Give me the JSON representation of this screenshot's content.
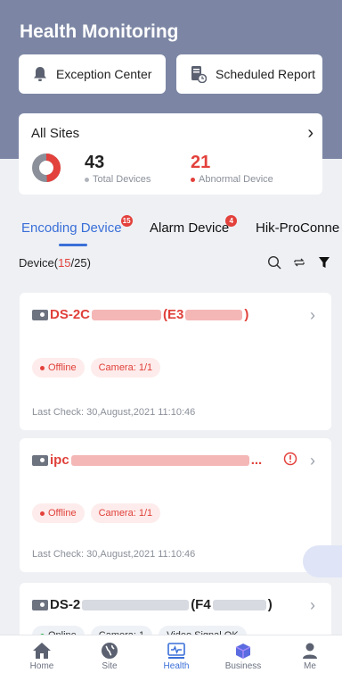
{
  "header": {
    "title": "Health Monitoring",
    "buttons": [
      {
        "label": "Exception Center",
        "icon": "bell-icon"
      },
      {
        "label": "Scheduled Report",
        "icon": "report-icon"
      }
    ]
  },
  "sites": {
    "title": "All Sites",
    "total_devices": "43",
    "total_label": "Total Devices",
    "abnormal_devices": "21",
    "abnormal_label": "Abnormal Device",
    "colors": {
      "abnormal": "#e3413c",
      "normal": "#8a8f99",
      "total_dot": "#b0b4bc"
    }
  },
  "tabs": [
    {
      "label": "Encoding Device",
      "badge": "15",
      "active": true
    },
    {
      "label": "Alarm Device",
      "badge": "4",
      "active": false
    },
    {
      "label": "Hik-ProConne",
      "badge": "",
      "active": false
    }
  ],
  "device_bar": {
    "prefix": "Device(",
    "abnormal": "15",
    "slash_total": "/25)"
  },
  "devices": [
    {
      "name_start": "DS-2C",
      "name_mid": "(E3",
      "name_end": ")",
      "status": "Offline",
      "camera": "Camera: 1/1",
      "last_check": "Last Check: 30,August,2021 11:10:46"
    },
    {
      "name_start": "ipc",
      "name_end": "...",
      "status": "Offline",
      "camera": "Camera: 1/1",
      "last_check": "Last Check: 30,August,2021 11:10:46"
    },
    {
      "name_start": "DS-2",
      "name_mid": "(F4",
      "name_end": ")",
      "status": "Online",
      "camera": "Camera: 1",
      "video": "Video Signal OK"
    }
  ],
  "nav": [
    {
      "label": "Home",
      "icon": "home-icon"
    },
    {
      "label": "Site",
      "icon": "globe-icon"
    },
    {
      "label": "Health",
      "icon": "health-icon"
    },
    {
      "label": "Business",
      "icon": "business-icon"
    },
    {
      "label": "Me",
      "icon": "user-icon"
    }
  ],
  "colors": {
    "header": "#7c86a4",
    "accent": "#3a6fd8",
    "error": "#e3413c",
    "online": "#2bb24c"
  }
}
